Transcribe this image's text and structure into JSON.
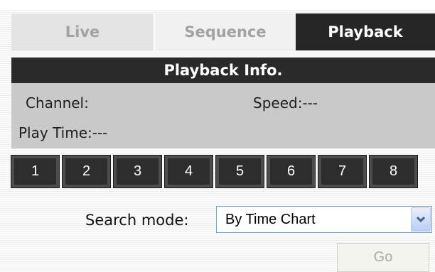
{
  "tabs": [
    {
      "label": "Live",
      "active": false
    },
    {
      "label": "Sequence",
      "active": false
    },
    {
      "label": "Playback",
      "active": true
    }
  ],
  "info": {
    "title": "Playback Info.",
    "channel_label": "Channel:",
    "speed_label": "Speed:",
    "speed_value": "---",
    "playtime_label": "Play Time:",
    "playtime_value": "---"
  },
  "channels": [
    "1",
    "2",
    "3",
    "4",
    "5",
    "6",
    "7",
    "8"
  ],
  "search": {
    "label": "Search mode:",
    "selected": "By Time Chart",
    "icon": "chevron-down-icon"
  },
  "go": {
    "label": "Go",
    "disabled": true
  },
  "colors": {
    "active_tab_bg": "#262626",
    "inactive_tab_text": "#a2a2a2",
    "panel_bg": "#c9c9c9",
    "panel_header_bg": "#2a2a2a",
    "channel_button_bg": "#2d2d2d",
    "dropdown_arrow": "#4d6185"
  }
}
